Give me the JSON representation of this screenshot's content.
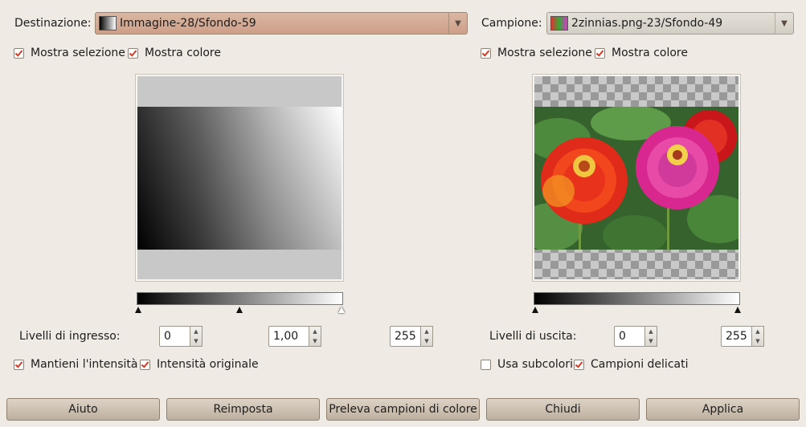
{
  "left": {
    "dest_label": "Destinazione:",
    "dest_value": "Immagine-28/Sfondo-59",
    "show_selection": "Mostra selezione",
    "show_color": "Mostra colore",
    "levels_label": "Livelli di ingresso:",
    "levels": [
      "0",
      "1,00",
      "255"
    ],
    "keep_intensity": "Mantieni l'intensità",
    "original_intensity": "Intensità originale"
  },
  "right": {
    "sample_label": "Campione:",
    "sample_value": "2zinnias.png-23/Sfondo-49",
    "show_selection": "Mostra selezione",
    "show_color": "Mostra colore",
    "levels_label": "Livelli di uscita:",
    "levels": [
      "0",
      "255"
    ],
    "use_subcolors": "Usa subcolori",
    "soft_samples": "Campioni delicati"
  },
  "buttons": {
    "help": "Aiuto",
    "reset": "Reimposta",
    "pick": "Preleva campioni di colore",
    "close": "Chiudi",
    "apply": "Applica"
  },
  "icons": {
    "combo_arrow": "▼",
    "spin_up": "▲",
    "spin_down": "▼"
  }
}
